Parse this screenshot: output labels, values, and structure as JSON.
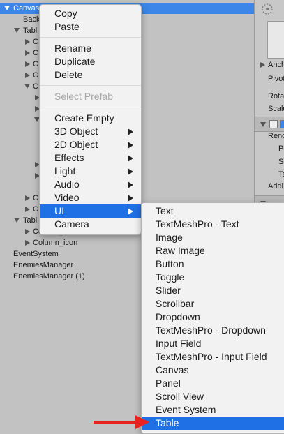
{
  "hierarchy": {
    "items": [
      {
        "label": "Canvas"
      },
      {
        "label": "Back"
      },
      {
        "label": "Tabl"
      },
      {
        "label": "C"
      },
      {
        "label": "C"
      },
      {
        "label": "C"
      },
      {
        "label": "C"
      },
      {
        "label": "C"
      },
      {
        "label": "C"
      },
      {
        "label": "C"
      },
      {
        "label": "Tabl"
      },
      {
        "label": "Column_name"
      },
      {
        "label": "Column_icon"
      },
      {
        "label": "EventSystem"
      },
      {
        "label": "EnemiesManager"
      },
      {
        "label": "EnemiesManager (1)"
      }
    ]
  },
  "inspector": {
    "labels": [
      "Anch",
      "Pivot",
      "Rota",
      "Scale",
      "Rend",
      "Pi",
      "Sc",
      "Ta",
      "Addi"
    ]
  },
  "context_menu": {
    "copy": "Copy",
    "paste": "Paste",
    "rename": "Rename",
    "duplicate": "Duplicate",
    "delete": "Delete",
    "select_prefab": "Select Prefab",
    "create_empty": "Create Empty",
    "object_3d": "3D Object",
    "object_2d": "2D Object",
    "effects": "Effects",
    "light": "Light",
    "audio": "Audio",
    "video": "Video",
    "ui": "UI",
    "camera": "Camera"
  },
  "ui_submenu": {
    "items": [
      "Text",
      "TextMeshPro - Text",
      "Image",
      "Raw Image",
      "Button",
      "Toggle",
      "Slider",
      "Scrollbar",
      "Dropdown",
      "TextMeshPro - Dropdown",
      "Input Field",
      "TextMeshPro - Input Field",
      "Canvas",
      "Panel",
      "Scroll View",
      "Event System",
      "Table"
    ]
  },
  "colors": {
    "selection": "#3b86e8",
    "menu_highlight": "#1f6fe5",
    "annotation_arrow": "#e8231f"
  }
}
